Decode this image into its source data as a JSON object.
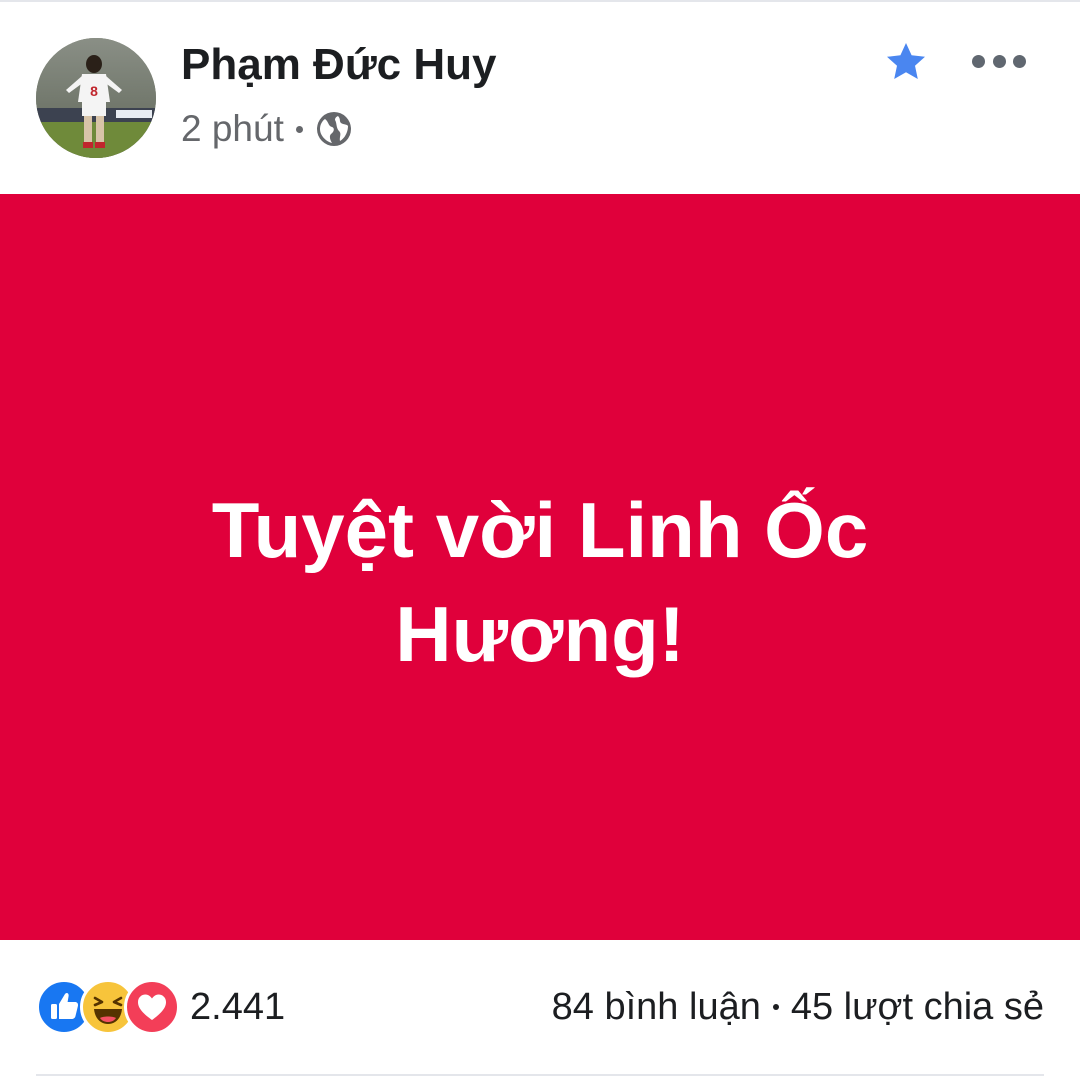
{
  "post": {
    "author_name": "Phạm Đức Huy",
    "time": "2 phút",
    "privacy_icon": "globe-icon",
    "favorite_icon": "star-icon",
    "more_icon": "more-options-icon",
    "text": "Tuyệt vời Linh Ốc Hương!",
    "background_color": "#e0003b",
    "text_color": "#ffffff"
  },
  "footer": {
    "reaction_icons": [
      "like-icon",
      "haha-icon",
      "love-icon"
    ],
    "reaction_count": "2.441",
    "comments": "84 bình luận",
    "shares": "45 lượt chia sẻ"
  },
  "colors": {
    "favorite_blue": "#4a86f0",
    "like_blue": "#1877f2",
    "haha_yellow": "#f7c43b",
    "love_red": "#f33e58",
    "secondary_text": "#65676b"
  }
}
